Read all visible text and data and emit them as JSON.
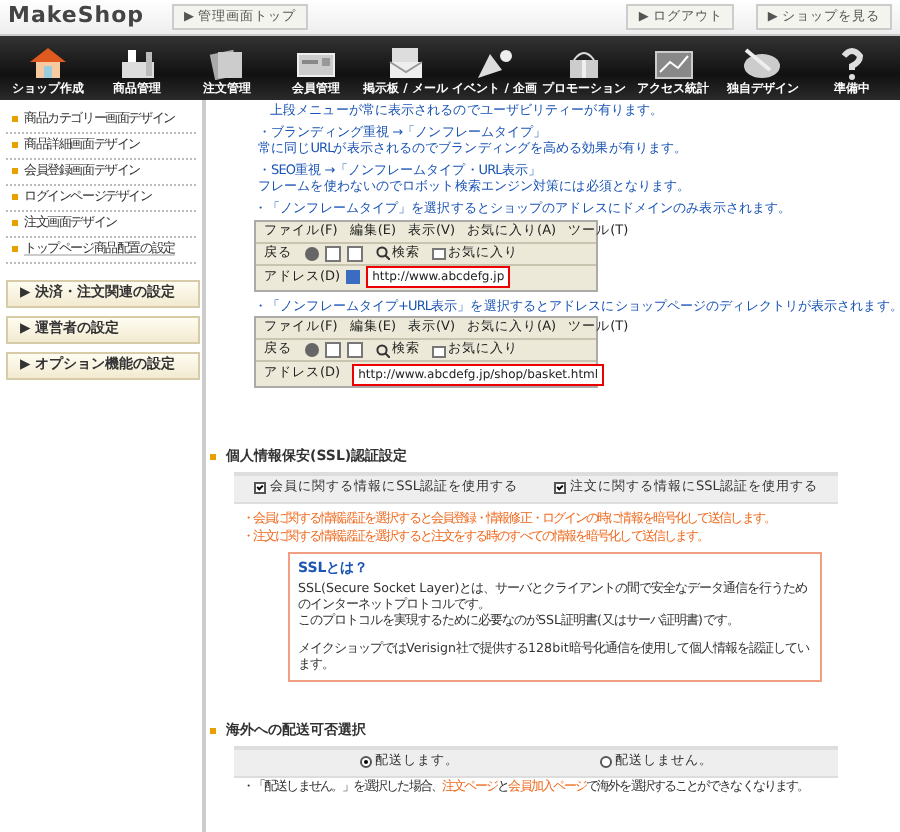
{
  "header": {
    "logo": "MakeShop",
    "top_link": "▶ 管理画面トップ",
    "logout": "▶ ログアウト",
    "view_shop": "▶ ショップを見る"
  },
  "nav": [
    {
      "label": "ショップ作成"
    },
    {
      "label": "商品管理"
    },
    {
      "label": "注文管理"
    },
    {
      "label": "会員管理"
    },
    {
      "label": "掲示板 / メール"
    },
    {
      "label": "イベント / 企画"
    },
    {
      "label": "プロモーション"
    },
    {
      "label": "アクセス統計"
    },
    {
      "label": "独自デザイン"
    },
    {
      "label": "準備中"
    }
  ],
  "sidebar": {
    "items": [
      {
        "label": "商品カテゴリー画面デザイン",
        "kind": "plain"
      },
      {
        "label": "商品詳細画面デザイン",
        "kind": "plain"
      },
      {
        "label": "会員登録画面デザイン",
        "kind": "plain"
      },
      {
        "label": "ログインページデザイン",
        "kind": "plain"
      },
      {
        "label": "注文画面デザイン",
        "kind": "plain"
      },
      {
        "label": "トップページ商品配置の設定",
        "kind": "link"
      }
    ],
    "sections": [
      "▶ 決済・注文関連の設定",
      "▶ 運営者の設定",
      "▶ オプション機能の設定"
    ]
  },
  "frame_notes": [
    {
      "lines": [
        "上段メニューが常に表示されるのでユーザビリティーが有ります。"
      ],
      "kind": "continuation"
    },
    {
      "lines": [
        "・ブランディング重視 →「ノンフレームタイプ」",
        "常に同じURLが表示されるのでブランディングを高める効果が有ります。"
      ],
      "kind": "bullet"
    },
    {
      "lines": [
        "・SEO重視 →「ノンフレームタイプ・URL表示」",
        "フレームを使わないのでロボット検索エンジン対策には必須となります。"
      ],
      "kind": "bullet"
    }
  ],
  "examples": [
    {
      "caption": "・「ノンフレームタイプ」を選択するとショップのアドレスにドメインのみ表示されます。",
      "menu": [
        "ファイル(F)",
        "編集(E)",
        "表示(V)",
        "お気に入り(A)",
        "ツール(T)"
      ],
      "back": "戻る",
      "search": "検索",
      "favorites": "お気に入り",
      "address_label": "アドレス(D)",
      "url": "http://www.abcdefg.jp"
    },
    {
      "caption": "・「ノンフレームタイプ+URL表示」を選択するとアドレスにショップページのディレクトリが表示されます。",
      "menu": [
        "ファイル(F)",
        "編集(E)",
        "表示(V)",
        "お気に入り(A)",
        "ツール(T)"
      ],
      "back": "戻る",
      "search": "検索",
      "favorites": "お気に入り",
      "address_label": "アドレス(D)",
      "url": "http://www.abcdefg.jp/shop/basket.html"
    }
  ],
  "ssl": {
    "title": "個人情報保安(SSL)認証設定",
    "options": [
      {
        "label": "会員に関する情報にSSL認証を使用する",
        "checked": true
      },
      {
        "label": "注文に関する情報にSSL認証を使用する",
        "checked": true
      }
    ],
    "notes": [
      "・会員に関する情報認証を選択すると会員登録・情報修正・ログインの時に情報を暗号化して送信します。",
      "・注文に関する情報認証を選択すると注文をする時のすべての情報を暗号化して送信します。"
    ],
    "info": {
      "title": "SSLとは？",
      "paragraphs": [
        "SSL(Secure Socket Layer)とは、サーバとクライアントの間で安全なデータ通信を行うためのインターネットプロトコルです。",
        "このプロトコルを実現するために必要なのがSSL証明書(又はサーバ証明書)です。",
        "メイクショップではVerisign社で提供する128bit暗号化通信を使用して個人情報を認証しています。"
      ]
    }
  },
  "shipping": {
    "title": "海外への配送可否選択",
    "options": [
      {
        "label": "配送します。",
        "selected": true
      },
      {
        "label": "配送しません。",
        "selected": false
      }
    ],
    "note": [
      {
        "text": "・「配送しません。」を選択した場合、",
        "kind": "text"
      },
      {
        "text": "注文ページ",
        "kind": "link"
      },
      {
        "text": "と",
        "kind": "text"
      },
      {
        "text": "会員加入ページ",
        "kind": "link"
      },
      {
        "text": "で海外を選択することができなくなります。",
        "kind": "text"
      }
    ]
  }
}
